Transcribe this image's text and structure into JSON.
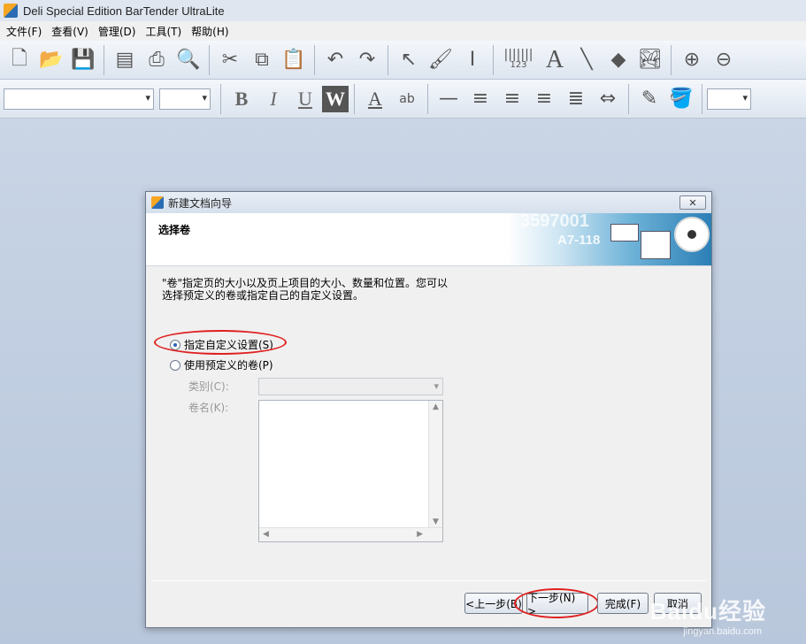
{
  "window": {
    "title": "Deli Special Edition BarTender UltraLite"
  },
  "menu": [
    "文件(F)",
    "查看(V)",
    "管理(D)",
    "工具(T)",
    "帮助(H)"
  ],
  "toolbar": {
    "barcode_caption": "123",
    "bold": "B",
    "italic": "I",
    "underline": "U",
    "wordart": "W",
    "text_tool": "A",
    "font_color": "A",
    "highlight_text": "ab"
  },
  "dialog": {
    "title": "新建文档向导",
    "heading": "选择卷",
    "description": "\"卷\"指定页的大小以及页上项目的大小、数量和位置。您可以选择预定义的卷或指定自己的自定义设置。",
    "banner_text_1": "3597001",
    "banner_text_2": "A7-118",
    "option_custom": "指定自定义设置(S)",
    "option_predefined": "使用预定义的卷(P)",
    "category_label": "类别(C):",
    "roll_name_label": "卷名(K):",
    "buttons": {
      "back": "<上一步(B)",
      "next": "下一步(N) >",
      "finish": "完成(F)",
      "cancel": "取消"
    },
    "selected_option": "custom"
  },
  "watermark": {
    "brand": "Baidu经验",
    "url": "jingyan.baidu.com"
  }
}
